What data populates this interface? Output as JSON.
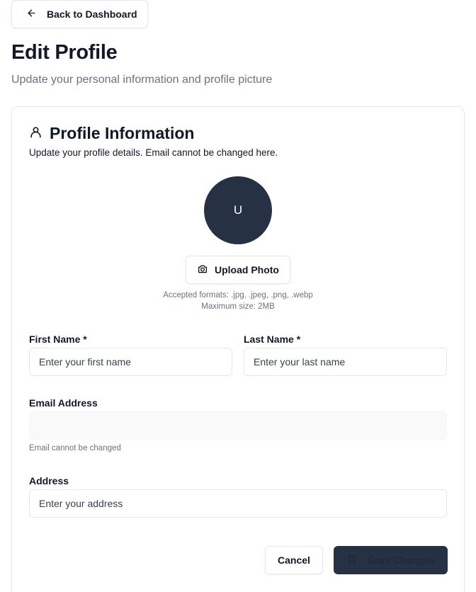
{
  "nav": {
    "back_label": "Back to Dashboard",
    "back_icon": "arrow-left-icon"
  },
  "header": {
    "title": "Edit Profile",
    "subtitle": "Update your personal information and profile picture"
  },
  "card": {
    "title": "Profile Information",
    "title_icon": "user-icon",
    "description": "Update your profile details. Email cannot be changed here."
  },
  "avatar": {
    "initial": "U",
    "background": "#263244"
  },
  "upload": {
    "label": "Upload Photo",
    "icon": "camera-icon",
    "formats_hint": "Accepted formats: .jpg, .jpeg, .png, .webp",
    "size_hint": "Maximum size: 2MB"
  },
  "form": {
    "first_name": {
      "label": "First Name *",
      "placeholder": "Enter your first name",
      "value": ""
    },
    "last_name": {
      "label": "Last Name *",
      "placeholder": "Enter your last name",
      "value": ""
    },
    "email": {
      "label": "Email Address",
      "value": "",
      "note": "Email cannot be changed",
      "disabled": true
    },
    "address": {
      "label": "Address",
      "placeholder": "Enter your address",
      "value": ""
    }
  },
  "actions": {
    "cancel_label": "Cancel",
    "save_label": "Save Changes",
    "save_icon": "save-icon"
  },
  "colors": {
    "primary": "#263244",
    "border": "#e5e7eb",
    "muted_text": "#6b7280"
  }
}
